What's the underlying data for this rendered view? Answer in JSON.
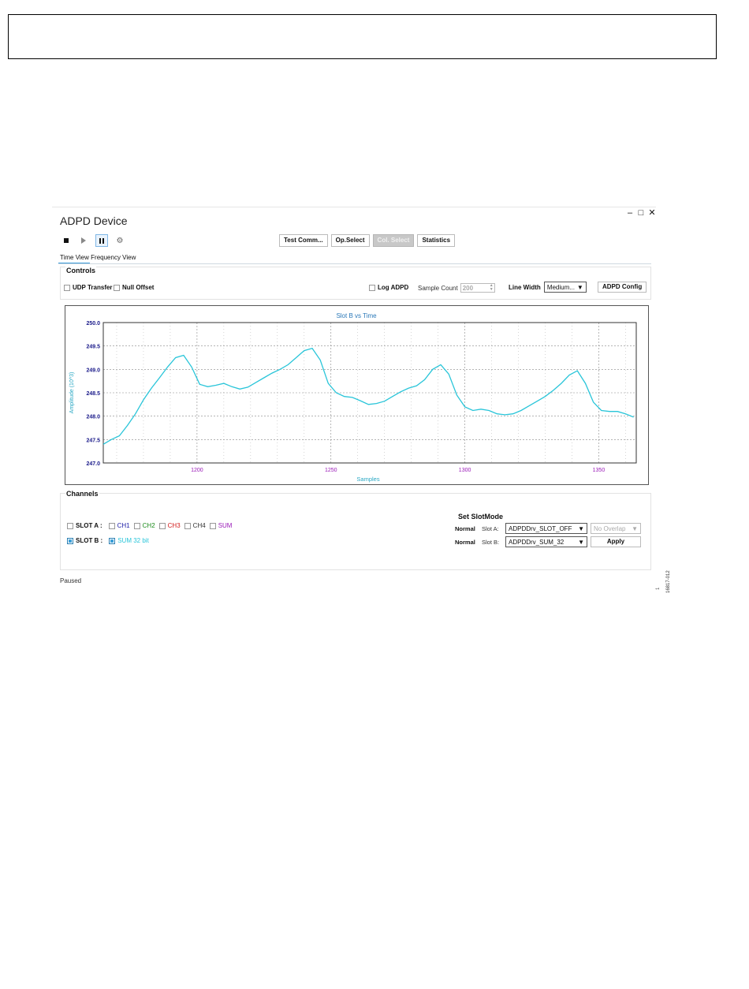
{
  "window": {
    "title": "ADPD Device",
    "controls": {
      "minimize": "–",
      "maximize": "□",
      "close": "✕"
    }
  },
  "toolbar": {
    "icons": [
      "stop-icon",
      "play-icon",
      "pause-icon",
      "gear-icon"
    ],
    "buttons": [
      {
        "label": "Test Comm...",
        "disabled": false
      },
      {
        "label": "Op.Select",
        "disabled": false
      },
      {
        "label": "Col. Select",
        "disabled": true
      },
      {
        "label": "Statistics",
        "disabled": false
      }
    ]
  },
  "tabs": {
    "time_view": "Time View",
    "frequency_view": "Frequency View"
  },
  "controls": {
    "title": "Controls",
    "udp_transfer": "UDP Transfer",
    "null_offset": "Null Offset",
    "log_adpd": "Log ADPD",
    "sample_count_label": "Sample Count",
    "sample_count_value": "200",
    "line_width_label": "Line Width",
    "line_width_value": "Medium...",
    "adpd_config": "ADPD Config"
  },
  "chart_data": {
    "type": "line",
    "title": "Slot B vs Time",
    "xlabel": "Samples",
    "ylabel": "Amplitude (10^3)",
    "xlim": [
      1165,
      1364
    ],
    "ylim": [
      247.0,
      250.0
    ],
    "x_ticks": [
      1200,
      1250,
      1300,
      1350
    ],
    "y_ticks": [
      "247.0",
      "247.5",
      "248.0",
      "248.5",
      "249.0",
      "249.5",
      "250.0"
    ],
    "grid": true,
    "color": "#29c5d9",
    "series": [
      {
        "x": [
          1165,
          1168,
          1171,
          1174,
          1177,
          1180,
          1183,
          1186,
          1189,
          1192,
          1195,
          1198,
          1201,
          1204,
          1207,
          1210,
          1213,
          1216,
          1219,
          1222,
          1225,
          1228,
          1231,
          1234,
          1237,
          1240,
          1243,
          1246,
          1249,
          1252,
          1255,
          1258,
          1261,
          1264,
          1267,
          1270,
          1273,
          1276,
          1279,
          1282,
          1285,
          1288,
          1291,
          1294,
          1297,
          1300,
          1303,
          1306,
          1309,
          1312,
          1315,
          1318,
          1321,
          1324,
          1327,
          1330,
          1333,
          1336,
          1339,
          1342,
          1345,
          1348,
          1351,
          1354,
          1357,
          1360,
          1363
        ],
        "y": [
          247.4,
          247.5,
          247.58,
          247.8,
          248.05,
          248.35,
          248.6,
          248.82,
          249.05,
          249.25,
          249.3,
          249.05,
          248.68,
          248.63,
          248.66,
          248.7,
          248.63,
          248.58,
          248.62,
          248.72,
          248.82,
          248.92,
          249.0,
          249.1,
          249.25,
          249.4,
          249.45,
          249.2,
          248.7,
          248.5,
          248.42,
          248.4,
          248.33,
          248.25,
          248.27,
          248.32,
          248.42,
          248.52,
          248.6,
          248.65,
          248.78,
          249.0,
          249.1,
          248.9,
          248.45,
          248.2,
          248.12,
          248.15,
          248.12,
          248.05,
          248.03,
          248.05,
          248.12,
          248.22,
          248.32,
          248.42,
          248.55,
          248.7,
          248.88,
          248.97,
          248.7,
          248.3,
          248.12,
          248.1,
          248.1,
          248.05,
          247.98
        ]
      }
    ]
  },
  "channels": {
    "title": "Channels",
    "slot_a": {
      "label": "SLOT A :",
      "items": [
        {
          "label": "CH1",
          "color": "#1a1aa6"
        },
        {
          "label": "CH2",
          "color": "#1a8a1a"
        },
        {
          "label": "CH3",
          "color": "#d21a1a"
        },
        {
          "label": "CH4",
          "color": "#333333"
        },
        {
          "label": "SUM",
          "color": "#9a1ab8"
        }
      ]
    },
    "slot_b": {
      "label": "SLOT B :",
      "item": "SUM 32 bit",
      "item_color": "#29c5d9"
    }
  },
  "slot_mode": {
    "title": "Set SlotMode",
    "row_a": {
      "mode": "Normal",
      "slot": "Slot A:",
      "value": "ADPDDrv_SLOT_OFF",
      "extra": "No Overlap"
    },
    "row_b": {
      "mode": "Normal",
      "slot": "Slot B:",
      "value": "ADPDDrv_SUM_32",
      "apply": "Apply"
    }
  },
  "status": "Paused",
  "figure_code": "16817-012",
  "side_mark": "1"
}
